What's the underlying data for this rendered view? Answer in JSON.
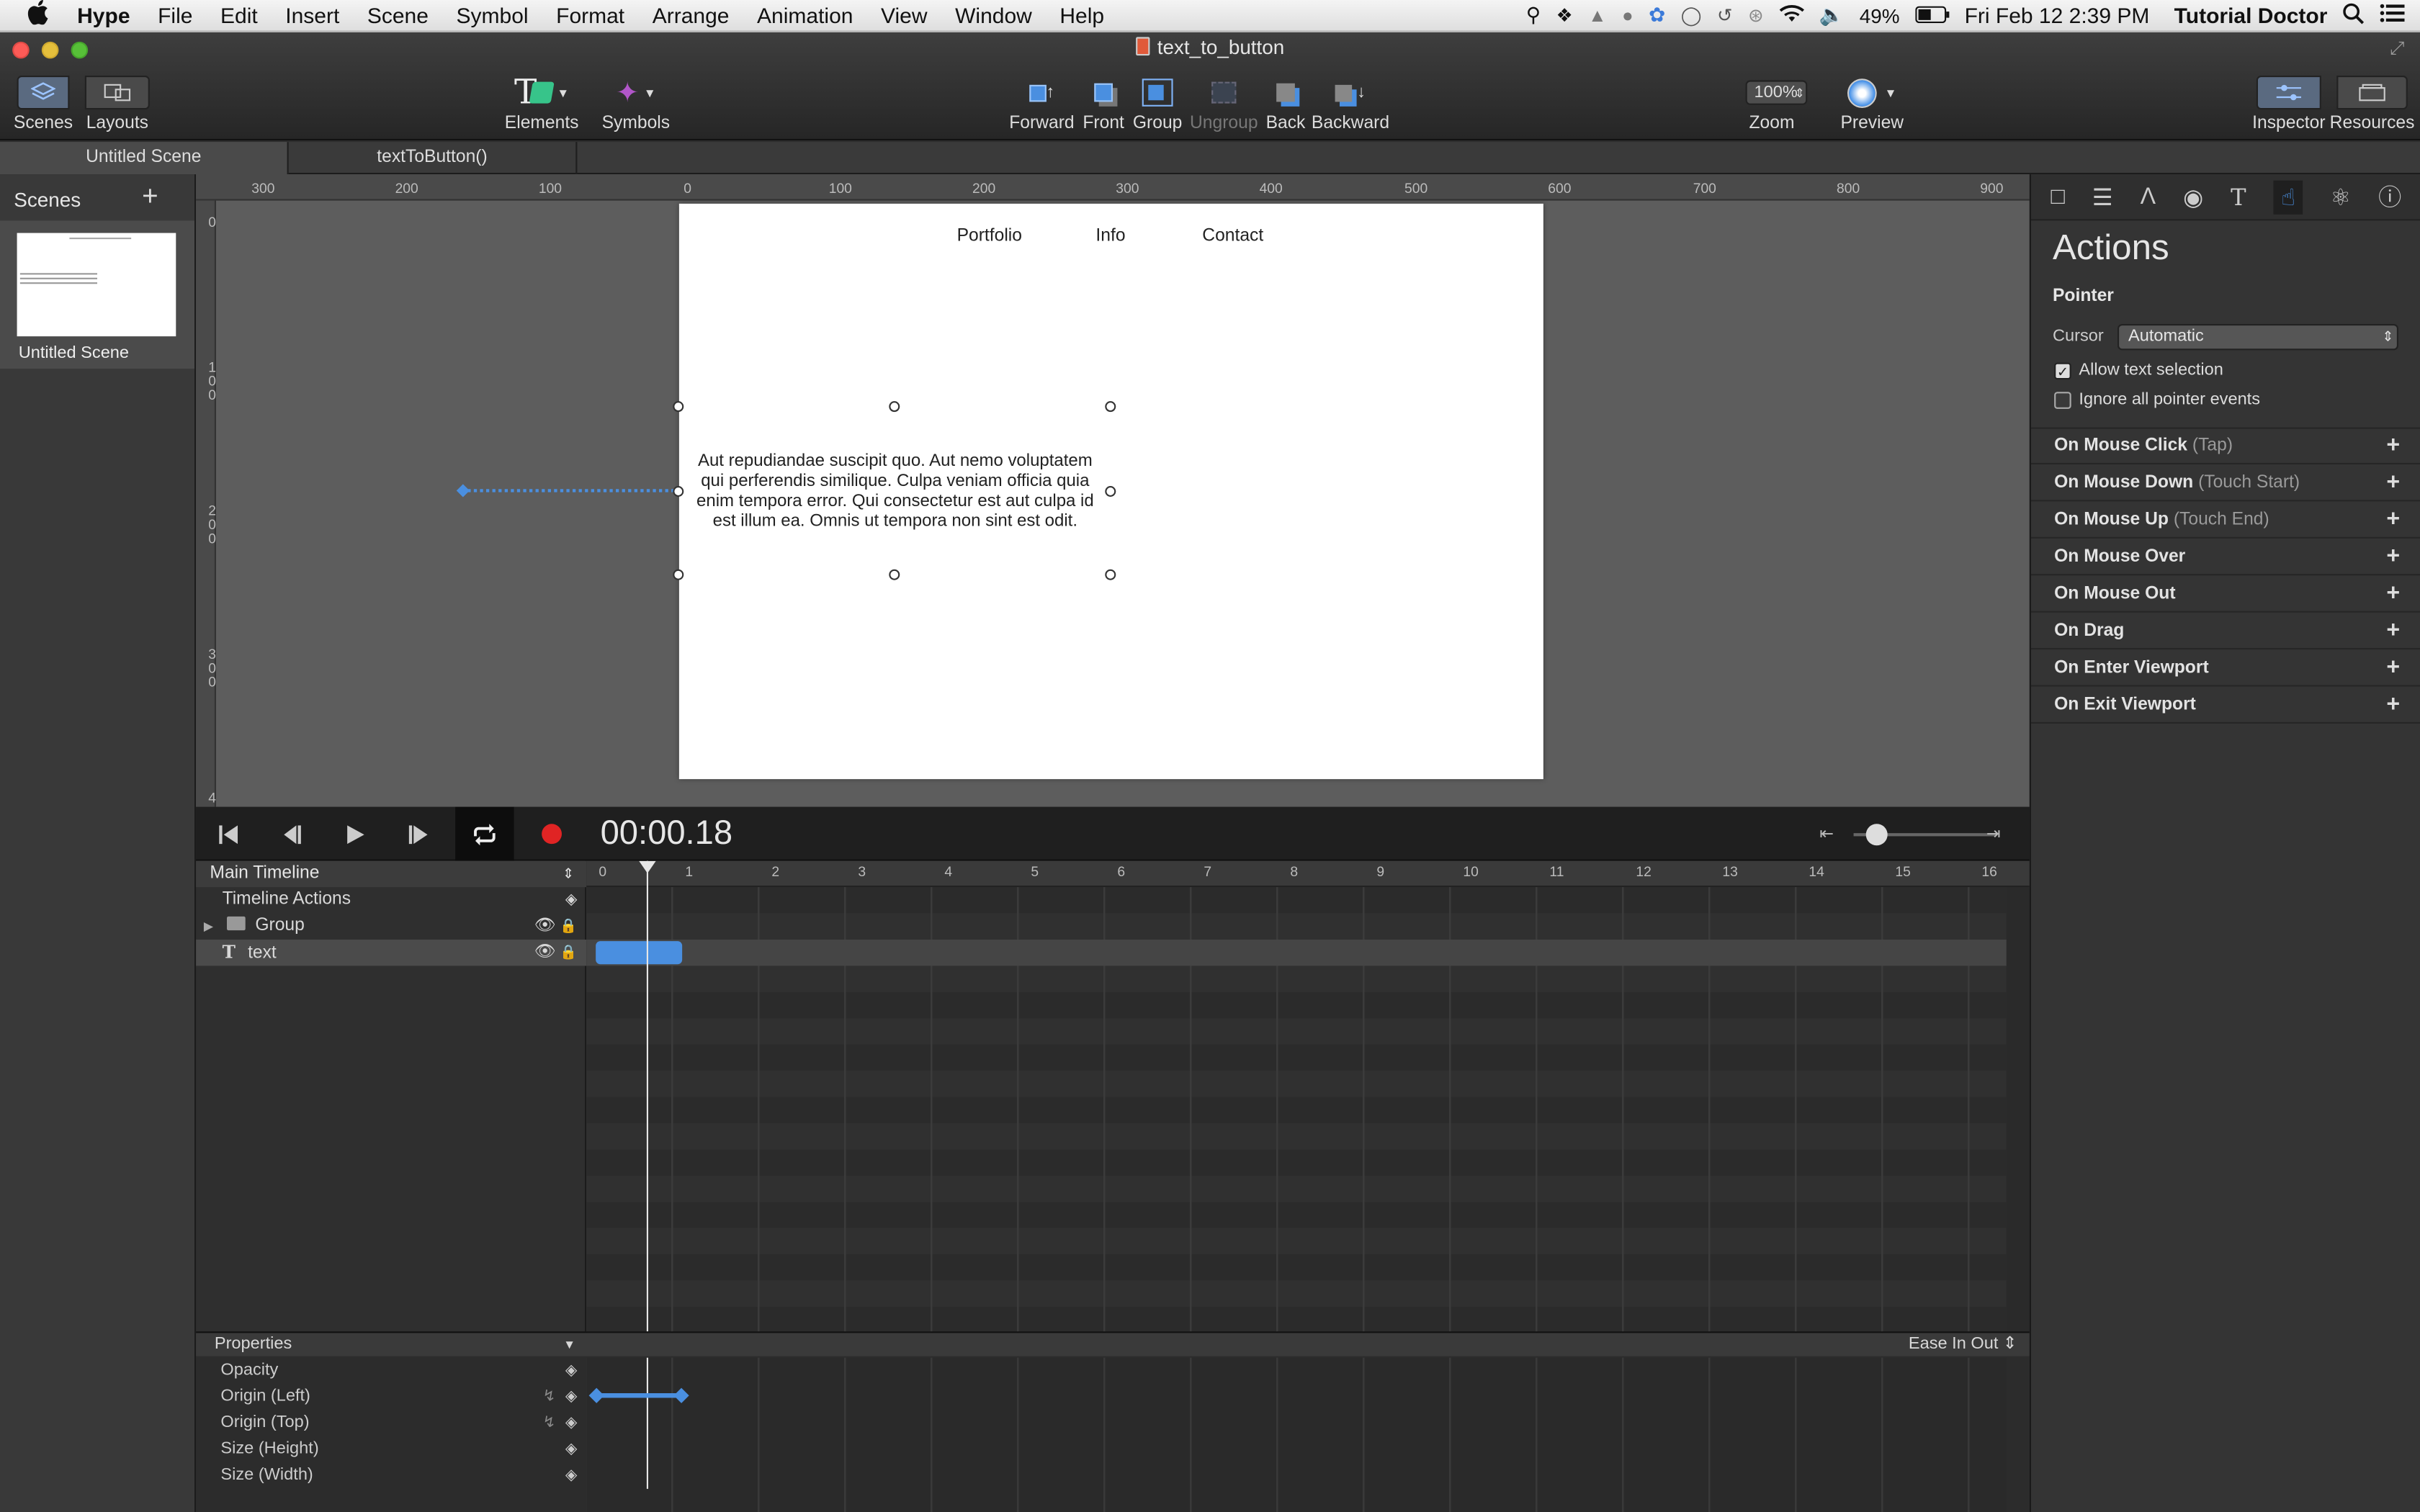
{
  "menubar": {
    "apple": "",
    "items": [
      "Hype",
      "File",
      "Edit",
      "Insert",
      "Scene",
      "Symbol",
      "Format",
      "Arrange",
      "Animation",
      "View",
      "Window",
      "Help"
    ],
    "battery": "49%",
    "clock": "Fri Feb 12  2:39 PM",
    "user": "Tutorial Doctor"
  },
  "window": {
    "title": "text_to_button"
  },
  "toolbar": {
    "scenes": "Scenes",
    "layouts": "Layouts",
    "elements": "Elements",
    "symbols": "Symbols",
    "forward": "Forward",
    "front": "Front",
    "group": "Group",
    "ungroup": "Ungroup",
    "back": "Back",
    "backward": "Backward",
    "zoom_value": "100%",
    "zoom": "Zoom",
    "preview": "Preview",
    "inspector": "Inspector",
    "resources": "Resources"
  },
  "tabs": [
    {
      "label": "Untitled Scene"
    },
    {
      "label": "textToButton()"
    }
  ],
  "scenes_panel": {
    "title": "Scenes",
    "add": "+",
    "scene_name": "Untitled Scene"
  },
  "ruler": {
    "h": [
      "300",
      "200",
      "100",
      "0",
      "100",
      "200",
      "300",
      "400",
      "500",
      "600",
      "700",
      "800",
      "900"
    ],
    "v": [
      "0",
      "1\n0\n0",
      "2\n0\n0",
      "3\n0\n0",
      "4"
    ]
  },
  "stage": {
    "nav": [
      "Portfolio",
      "Info",
      "Contact"
    ],
    "text": "Aut repudiandae suscipit quo. Aut nemo voluptatem qui perferendis similique. Culpa veniam officia quia enim tempora error. Qui consectetur est aut culpa id est illum ea. Omnis ut tempora non sint est odit."
  },
  "timeline": {
    "time": "00:00.18",
    "main": "Main Timeline",
    "actions": "Timeline Actions",
    "layers": [
      {
        "name": "Group"
      },
      {
        "name": "text"
      }
    ],
    "ticks": [
      "0",
      "1",
      "2",
      "3",
      "4",
      "5",
      "6",
      "7",
      "8",
      "9",
      "10",
      "11",
      "12",
      "13",
      "14",
      "15",
      "16"
    ],
    "properties_title": "Properties",
    "ease": "Ease In Out ⇕",
    "properties": [
      "Opacity",
      "Origin (Left)",
      "Origin (Top)",
      "Size (Height)",
      "Size (Width)"
    ]
  },
  "inspector": {
    "title": "Actions",
    "pointer": "Pointer",
    "cursor_label": "Cursor",
    "cursor_value": "Automatic",
    "allow_text": "Allow text selection",
    "allow_text_checked": true,
    "ignore_pointer": "Ignore all pointer events",
    "ignore_pointer_checked": false,
    "actions": [
      {
        "name": "On Mouse Click",
        "sub": "(Tap)"
      },
      {
        "name": "On Mouse Down",
        "sub": "(Touch Start)"
      },
      {
        "name": "On Mouse Up",
        "sub": "(Touch End)"
      },
      {
        "name": "On Mouse Over",
        "sub": ""
      },
      {
        "name": "On Mouse Out",
        "sub": ""
      },
      {
        "name": "On Drag",
        "sub": ""
      },
      {
        "name": "On Enter Viewport",
        "sub": ""
      },
      {
        "name": "On Exit Viewport",
        "sub": ""
      }
    ]
  },
  "colors": {
    "accent": "#4a90e2",
    "record": "#e02424"
  }
}
